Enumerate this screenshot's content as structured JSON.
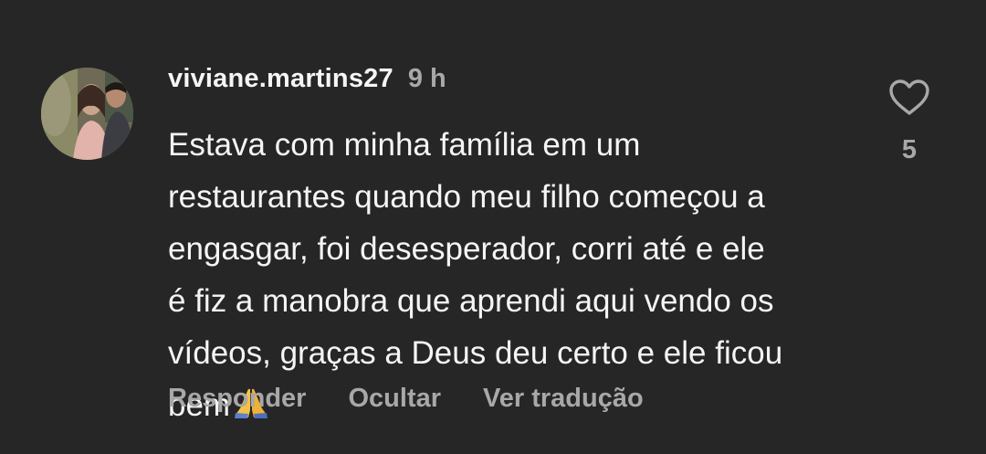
{
  "comment": {
    "username": "viviane.martins27",
    "timestamp": "9 h",
    "body_lines": [
      "Estava com minha família em um",
      "restaurantes quando meu filho começou a",
      "engasgar, foi desesperador, corri até e ele",
      "é fiz a manobra que aprendi aqui vendo os",
      "vídeos, graças a Deus deu certo e ele ficou",
      "bem"
    ],
    "emoji": "folded-hands-emoji",
    "actions": {
      "reply": "Responder",
      "hide": "Ocultar",
      "translate": "Ver tradução"
    },
    "like_icon": "heart-outline-icon",
    "like_count": "5"
  },
  "colors": {
    "background": "#262626",
    "primary_text": "#f5f5f5",
    "secondary_text": "#a8a8a8"
  }
}
